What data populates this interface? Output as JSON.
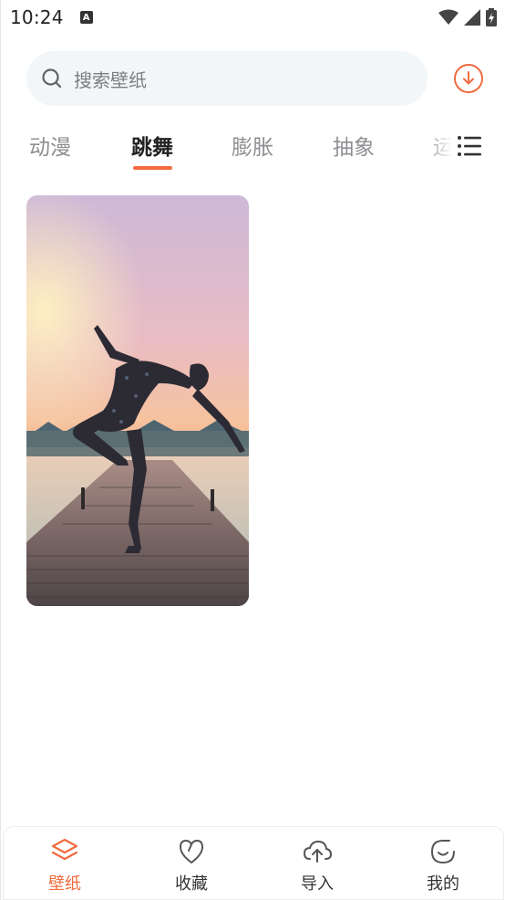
{
  "status_bar": {
    "time": "10:24",
    "notification_icon": "A"
  },
  "search": {
    "placeholder": "搜索壁纸"
  },
  "tabs": [
    {
      "label": "动漫",
      "active": false
    },
    {
      "label": "跳舞",
      "active": true
    },
    {
      "label": "膨胀",
      "active": false
    },
    {
      "label": "抽象",
      "active": false
    },
    {
      "label": "运",
      "active": false
    }
  ],
  "colors": {
    "accent": "#f06b3f",
    "search_bg": "#f2f6f9"
  },
  "wallpapers": [
    {
      "subject": "dancer-on-pier"
    }
  ],
  "bottom_nav": [
    {
      "label": "壁纸",
      "icon": "layers-icon",
      "active": true
    },
    {
      "label": "收藏",
      "icon": "heart-icon",
      "active": false
    },
    {
      "label": "导入",
      "icon": "cloud-upload-icon",
      "active": false
    },
    {
      "label": "我的",
      "icon": "smile-icon",
      "active": false
    }
  ]
}
